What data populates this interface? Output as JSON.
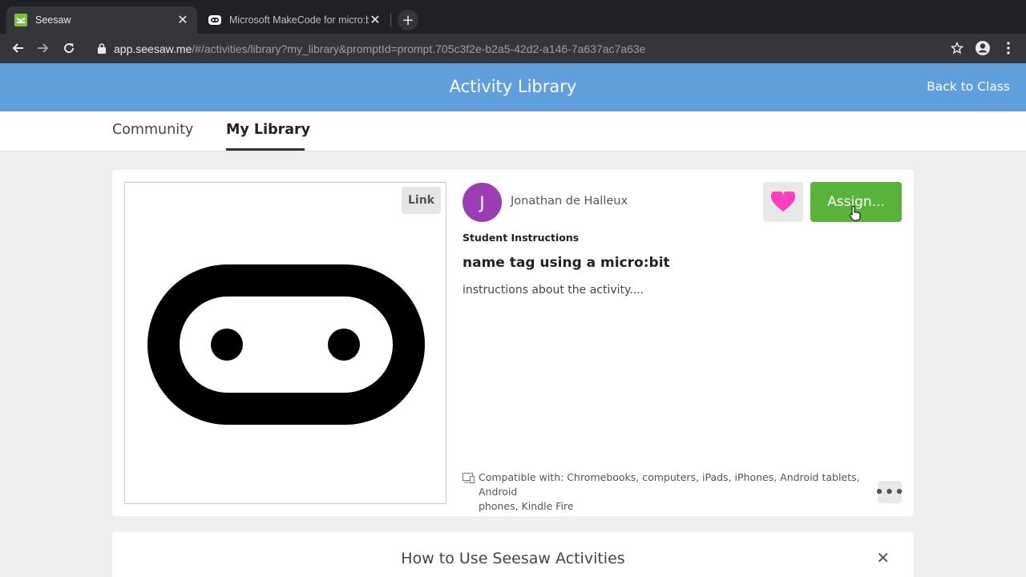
{
  "browser": {
    "tabs": [
      {
        "title": "Seesaw",
        "active": true
      },
      {
        "title": "Microsoft MakeCode for micro:bit",
        "active": false
      }
    ],
    "new_tab_label": "+",
    "close_glyph": "✕",
    "url_host": "app.seesaw.me",
    "url_path": "/#/activities/library?my_library&promptId=prompt.705c3f2e-b2a5-42d2-a146-7a637ac7a63e"
  },
  "header": {
    "title": "Activity Library",
    "back_link": "Back to Class",
    "color": "#5fa0dc"
  },
  "subnav": {
    "tabs": [
      {
        "label": "Community",
        "selected": false
      },
      {
        "label": "My Library",
        "selected": true
      }
    ]
  },
  "activity": {
    "preview_badge": "Link",
    "author_initial": "J",
    "author_name": "Jonathan de Halleux",
    "avatar_color": "#9b3db4",
    "assign_label": "Assign...",
    "assign_color": "#59b33b",
    "heart_color": "#ff3fbf",
    "instructions_label": "Student Instructions",
    "title": "name tag using a micro:bit",
    "description": "instructions about the activity....",
    "compat_line1": "Compatible with: Chromebooks, computers, iPads, iPhones, Android tablets, Android",
    "compat_line2": "phones, Kindle Fire",
    "more_label": "•••"
  },
  "howto": {
    "title": "How to Use Seesaw Activities",
    "close_glyph": "✕"
  },
  "icons": [
    "seesaw-favicon",
    "makecode-favicon",
    "back-arrow-icon",
    "forward-arrow-icon",
    "reload-icon",
    "lock-icon",
    "star-icon",
    "profile-icon",
    "menu-icon",
    "heart-icon",
    "device-icon",
    "cursor-icon",
    "microbit-logo"
  ]
}
